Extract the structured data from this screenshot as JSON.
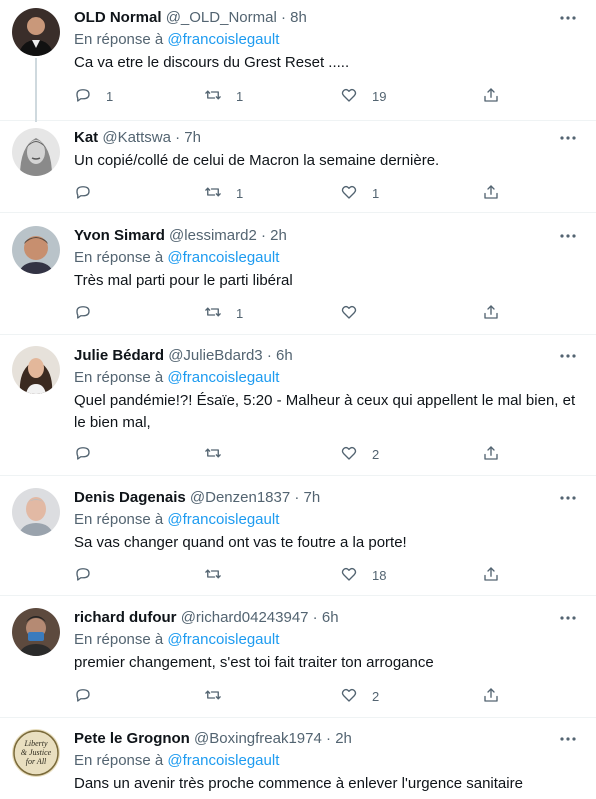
{
  "reply_prefix": "En réponse à",
  "tweets": [
    {
      "name": "OLD Normal",
      "handle": "@_OLD_Normal",
      "time": "8h",
      "reply_to": "@francoislegault",
      "text": "Ca va etre le discours du Grest Reset .....",
      "replies": "1",
      "retweets": "1",
      "likes": "19"
    },
    {
      "name": "Kat",
      "handle": "@Kattswa",
      "time": "7h",
      "reply_to": "",
      "text": "Un copié/collé de celui de Macron la semaine dernière.",
      "replies": "",
      "retweets": "1",
      "likes": "1"
    },
    {
      "name": "Yvon Simard",
      "handle": "@lessimard2",
      "time": "2h",
      "reply_to": "@francoislegault",
      "text": "Très mal parti pour le parti libéral",
      "replies": "",
      "retweets": "1",
      "likes": ""
    },
    {
      "name": "Julie Bédard",
      "handle": "@JulieBdard3",
      "time": "6h",
      "reply_to": "@francoislegault",
      "text": "Quel pandémie!?! Ésaïe, 5:20 - Malheur à ceux qui appellent le mal bien, et le bien mal,",
      "replies": "",
      "retweets": "",
      "likes": "2"
    },
    {
      "name": "Denis Dagenais",
      "handle": "@Denzen1837",
      "time": "7h",
      "reply_to": "@francoislegault",
      "text": "Sa vas changer quand ont vas te foutre a la porte!",
      "replies": "",
      "retweets": "",
      "likes": "18"
    },
    {
      "name": "richard dufour",
      "handle": "@richard04243947",
      "time": "6h",
      "reply_to": "@francoislegault",
      "text": "premier changement, s'est toi fait traiter ton arrogance",
      "replies": "",
      "retweets": "",
      "likes": "2"
    },
    {
      "name": "Pete le Grognon",
      "handle": "@Boxingfreak1974",
      "time": "2h",
      "reply_to": "@francoislegault",
      "text": "Dans un avenir très proche commence à enlever l'urgence sanitaire",
      "replies": "",
      "retweets": "",
      "likes": "",
      "avatar_text": [
        "Liberty",
        "& Justice",
        "for All"
      ]
    }
  ],
  "icons": {
    "reply": "reply-icon",
    "retweet": "retweet-icon",
    "like": "heart-icon",
    "share": "share-icon",
    "more": "more-icon"
  },
  "colors": {
    "link": "#1d9bf0",
    "muted": "#536471",
    "text": "#0f1419",
    "divider": "#eff3f4"
  }
}
